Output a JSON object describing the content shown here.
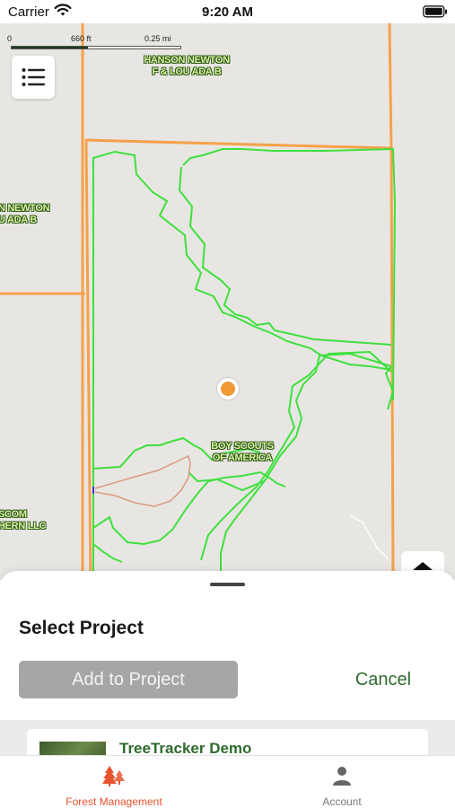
{
  "status_bar": {
    "carrier": "Carrier",
    "time": "9:20 AM"
  },
  "map": {
    "scale": {
      "start": "0",
      "mid": "660 ft",
      "end": "0.25 mi"
    },
    "parcel_labels": [
      {
        "line1": "HANSON NEWTON",
        "line2": "F & LOU ADA B"
      },
      {
        "line1": "N NEWTON",
        "line2": "U ADA B"
      },
      {
        "line1": "BOY SCOUTS",
        "line2": "OF AMERICA"
      },
      {
        "line1": "SCOM",
        "line2": "HERN LLC"
      }
    ],
    "colors": {
      "parcel": "#f5a14a",
      "boundary": "#3ee03e",
      "trail": "#d99a80",
      "location": "#f09a36"
    },
    "icons": {
      "menu": "list-icon",
      "collapse": "chevron-up-icon"
    }
  },
  "sheet": {
    "title": "Select Project",
    "add_label": "Add to Project",
    "cancel_label": "Cancel",
    "projects": [
      {
        "name": "TreeTracker Demo"
      }
    ]
  },
  "tabs": [
    {
      "label": "Forest Management",
      "icon": "trees-icon",
      "active": true,
      "color": "#e8532f"
    },
    {
      "label": "Account",
      "icon": "person-icon",
      "active": false,
      "color": "#777777"
    }
  ]
}
